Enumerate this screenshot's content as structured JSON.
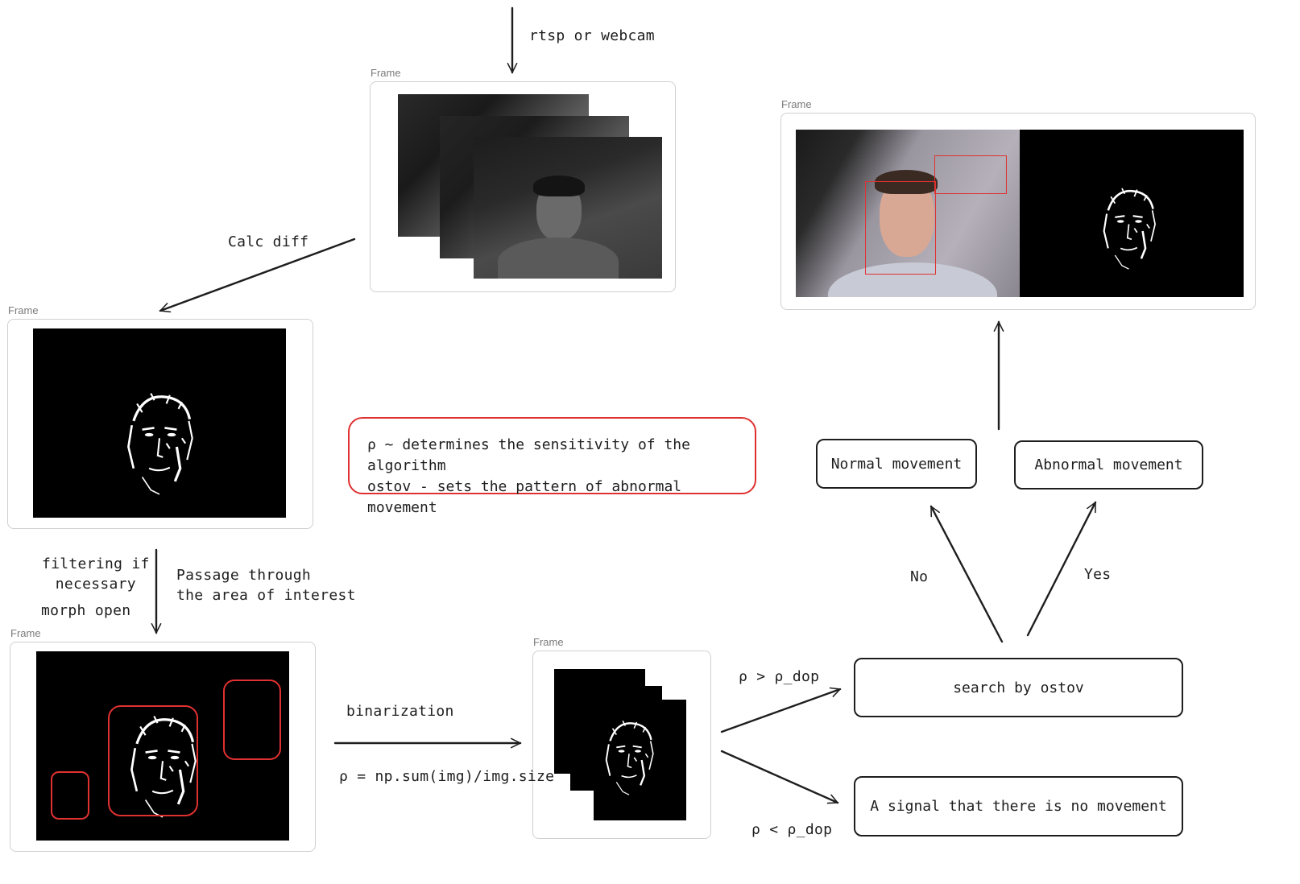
{
  "frame_label": "Frame",
  "labels": {
    "input_source": "rtsp or webcam",
    "calc_diff": "Calc diff",
    "filtering": "filtering if\nnecessary",
    "morph_open": "morph open",
    "passage": "Passage through\nthe area of interest",
    "binarization": "binarization",
    "rho_formula": "ρ = np.sum(img)/img.size",
    "rho_greater": "ρ > ρ_dop",
    "rho_less": "ρ < ρ_dop",
    "no": "No",
    "yes": "Yes"
  },
  "note": {
    "line1": "ρ ~ determines the sensitivity of the algorithm",
    "line2": "ostov - sets the pattern of abnormal movement"
  },
  "boxes": {
    "normal": "Normal movement",
    "abnormal": "Abnormal movement",
    "search": "search by ostov",
    "no_movement": "A signal that there is no movement"
  },
  "colors": {
    "stroke": "#1e1e1e",
    "accent_red": "#e03131",
    "frame_border": "#d0d0d0",
    "label_gray": "#7a7a7a"
  }
}
